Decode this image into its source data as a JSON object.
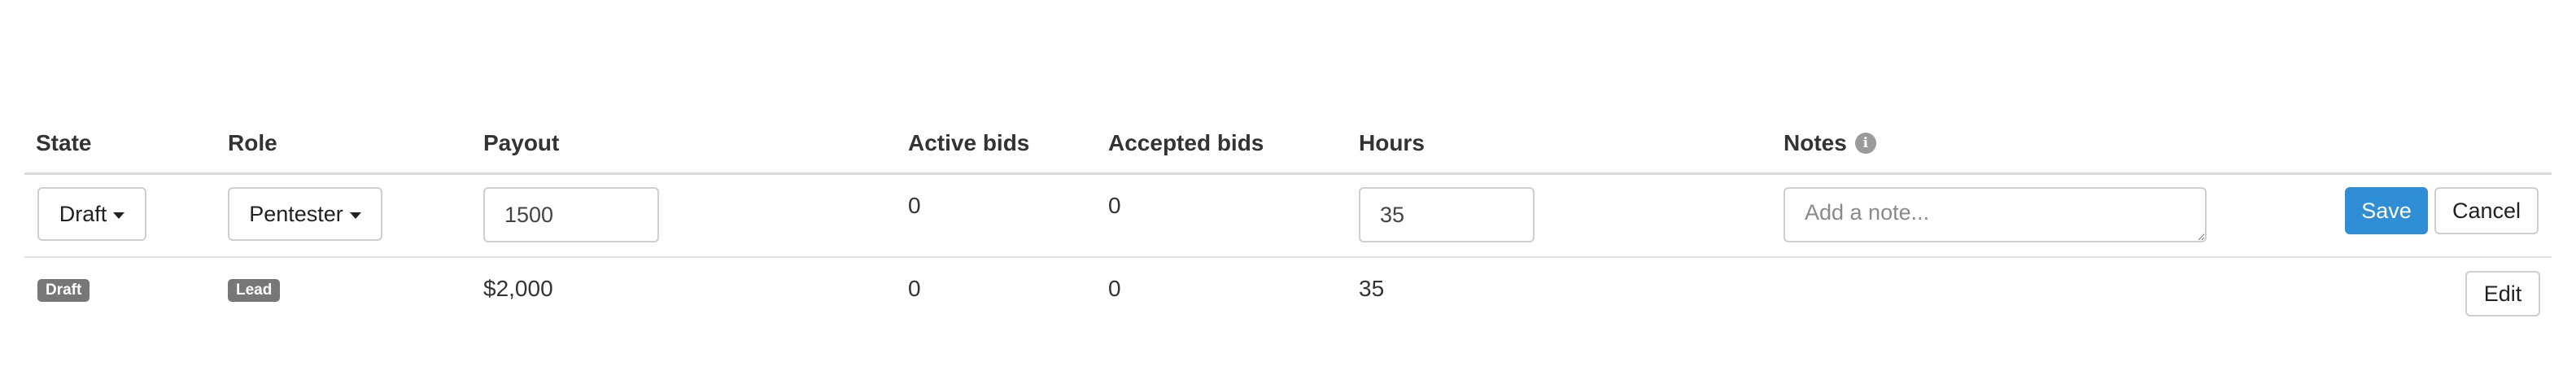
{
  "table": {
    "headers": {
      "state": "State",
      "role": "Role",
      "payout": "Payout",
      "active_bids": "Active bids",
      "accepted_bids": "Accepted bids",
      "hours": "Hours",
      "notes": "Notes"
    },
    "notes_info_icon": "i",
    "edit_row": {
      "state_select": "Draft",
      "role_select": "Pentester",
      "payout_value": "1500",
      "active_bids": "0",
      "accepted_bids": "0",
      "hours_value": "35",
      "notes_placeholder": "Add a note...",
      "save_label": "Save",
      "cancel_label": "Cancel"
    },
    "view_row": {
      "state_badge": "Draft",
      "role_badge": "Lead",
      "payout": "$2,000",
      "active_bids": "0",
      "accepted_bids": "0",
      "hours": "35",
      "edit_label": "Edit"
    }
  },
  "colors": {
    "primary": "#2f8ed6",
    "badge": "#777777",
    "border": "#cfcfcf"
  },
  "icons": {
    "caret": "caret-down-icon",
    "info": "info-icon"
  }
}
